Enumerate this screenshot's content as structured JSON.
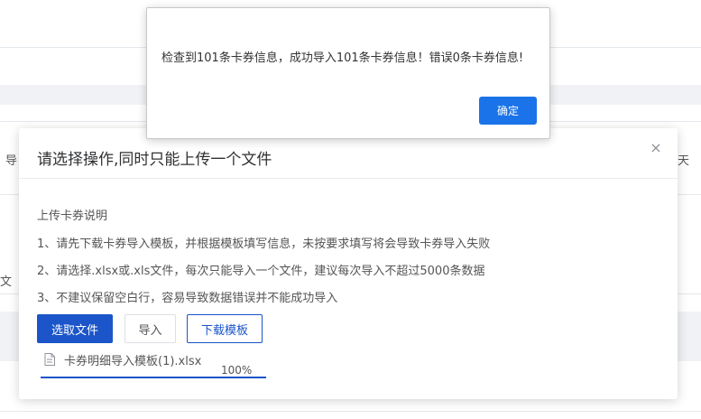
{
  "background": {
    "left_fragment_1": "导",
    "right_fragment": "天",
    "left_fragment_2": "文"
  },
  "dialog": {
    "title": "请选择操作,同时只能上传一个文件",
    "close_glyph": "×",
    "description_title": "上传卡券说明",
    "instructions": [
      "1、请先下载卡券导入模板，并根据模板填写信息，未按要求填写将会导致卡券导入失败",
      "2、请选择.xlsx或.xls文件，每次只能导入一个文件，建议每次导入不超过5000条数据",
      "3、不建议保留空白行，容易导致数据错误并不能成功导入"
    ],
    "buttons": {
      "select_file": "选取文件",
      "import": "导入",
      "download_template": "下载模板"
    },
    "file": {
      "icon": "document-icon",
      "name": "卡券明细导入模板(1).xlsx",
      "progress_text": "100%",
      "progress_fraction": 1.0
    }
  },
  "alert": {
    "message": "检查到101条卡券信息，成功导入101条卡券信息！错误0条卡券信息!",
    "ok_label": "确定"
  },
  "colors": {
    "primary": "#1b55c9",
    "alert_button": "#1a73e8"
  }
}
